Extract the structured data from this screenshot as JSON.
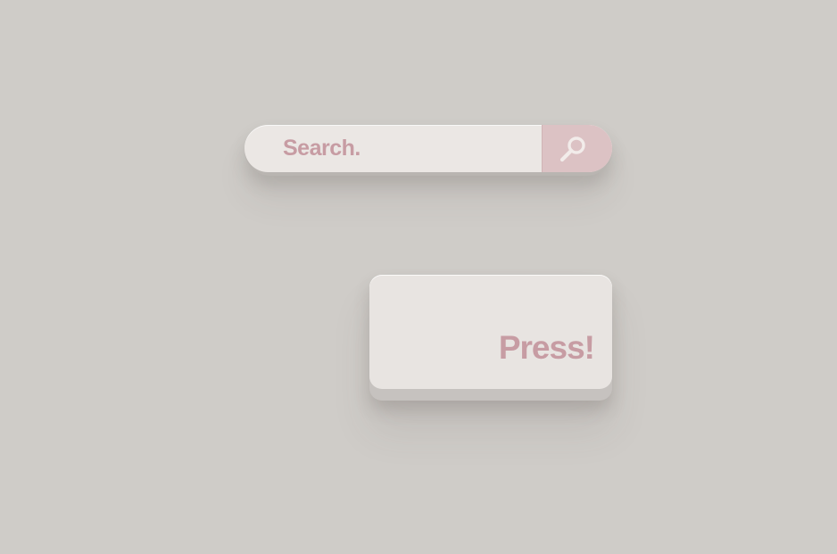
{
  "search": {
    "placeholder": "Search.",
    "button_icon": "search-icon"
  },
  "press_button": {
    "label": "Press!"
  },
  "colors": {
    "background": "#cfccc8",
    "surface": "#ebe7e4",
    "accent": "#dcc2c4",
    "text_accent": "#c79ca3"
  }
}
